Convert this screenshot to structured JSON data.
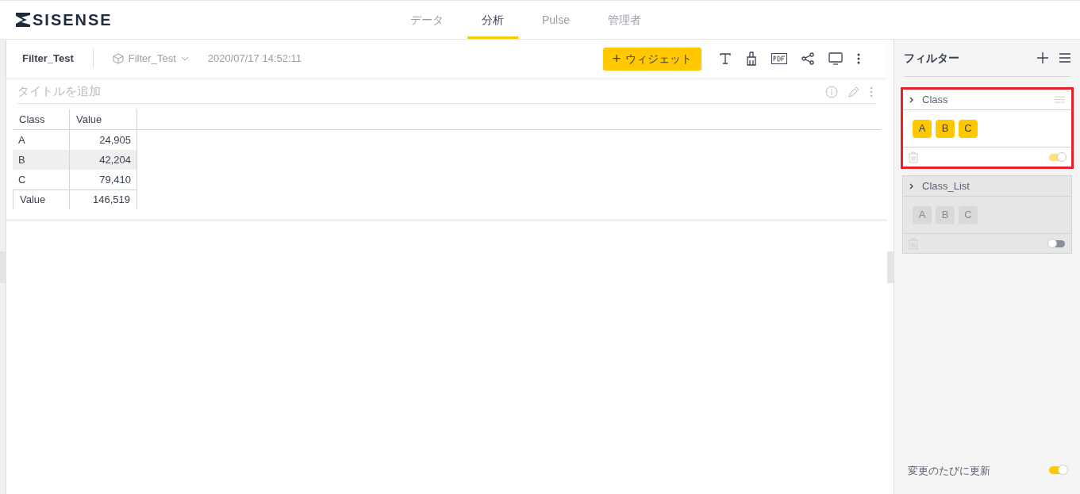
{
  "logo": {
    "text": "SISENSE"
  },
  "nav_tabs": [
    {
      "label": "データ",
      "selected": false
    },
    {
      "label": "分析",
      "selected": true
    },
    {
      "label": "Pulse",
      "selected": false
    },
    {
      "label": "管理者",
      "selected": false
    }
  ],
  "dashboard": {
    "title": "Filter_Test",
    "datasource": "Filter_Test",
    "updated": "2020/07/17 14:52:11",
    "add_widget_button": "ウィジェット",
    "add_widget_icon": "+"
  },
  "widget": {
    "title_placeholder": "タイトルを追加",
    "table": {
      "columns": [
        "Class",
        "Value"
      ],
      "rows": [
        {
          "cells": [
            "A",
            "24,905"
          ],
          "highlighted": false
        },
        {
          "cells": [
            "B",
            "42,204"
          ],
          "highlighted": true
        },
        {
          "cells": [
            "C",
            "79,410"
          ],
          "highlighted": false
        }
      ],
      "total": [
        "Value",
        "146,519"
      ]
    }
  },
  "filter_panel": {
    "title": "フィルター",
    "filters": [
      {
        "name": "Class",
        "enabled": true,
        "highlighted": true,
        "values": [
          "A",
          "B",
          "C"
        ]
      },
      {
        "name": "Class_List",
        "enabled": false,
        "highlighted": false,
        "values": [
          "A",
          "B",
          "C"
        ]
      }
    ],
    "auto_update": {
      "label": "変更のたびに更新",
      "on": true
    }
  }
}
